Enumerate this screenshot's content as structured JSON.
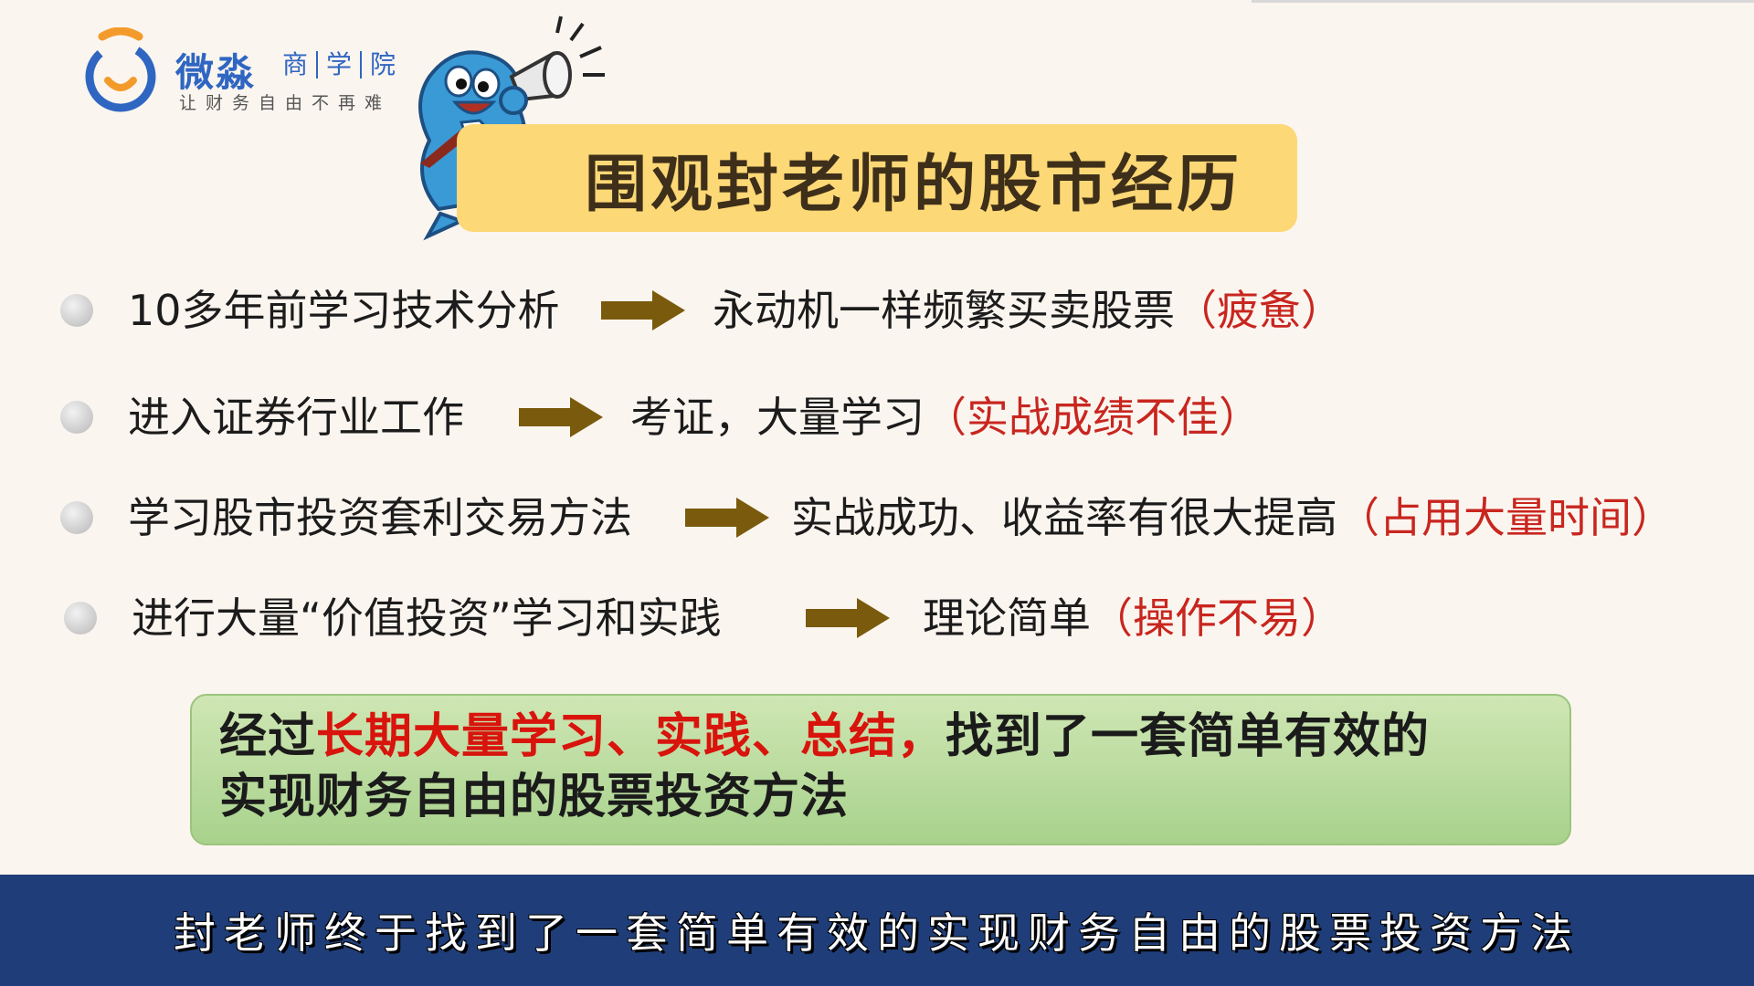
{
  "logo": {
    "name": "微淼",
    "sub": [
      "商",
      "学",
      "院"
    ],
    "slogan": "让财务自由不再难"
  },
  "title": "围观封老师的股市经历",
  "rows": [
    {
      "left": "10多年前学习技术分析",
      "right": "永动机一样频繁买卖股票",
      "note": "（疲惫）"
    },
    {
      "left": "进入证券行业工作",
      "right": "考证，大量学习",
      "note": "（实战成绩不佳）"
    },
    {
      "left": "学习股市投资套利交易方法",
      "right": "实战成功、收益率有很大提高",
      "note": "（占用大量时间）"
    },
    {
      "left": "进行大量“价值投资”学习和实践",
      "right": "理论简单",
      "note": "（操作不易）"
    }
  ],
  "summary": {
    "prefix": "经过",
    "highlight": "长期大量学习、实践、总结，",
    "suffix": "找到了一套简单有效的",
    "line2": "实现财务自由的股票投资方法"
  },
  "subtitle": "封老师终于找到了一套简单有效的实现财务自由的股票投资方法",
  "colors": {
    "background": "#fbf5ef",
    "title_box": "#fdd876",
    "arrow": "#7a5a0c",
    "note_red": "#c8261f",
    "summary_green": "#b8dc9c",
    "subtitle_band": "#1f3e79",
    "brand_blue": "#2f66c2"
  }
}
